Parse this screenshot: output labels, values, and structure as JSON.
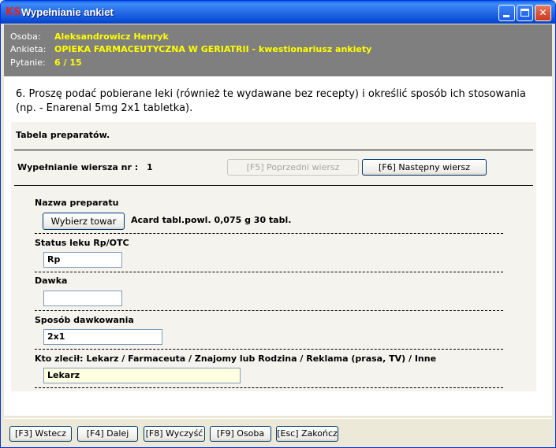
{
  "window": {
    "title": "Wypełnianie ankiet",
    "app_icon": "KS"
  },
  "info": {
    "person_label": "Osoba:",
    "person_value": "Aleksandrowicz Henryk",
    "survey_label": "Ankieta:",
    "survey_value": "OPIEKA FARMACEUTYCZNA W GERIATRII - kwestionariusz ankiety",
    "question_label": "Pytanie:",
    "question_value": "6 / 15"
  },
  "question": {
    "text": "6. Proszę podać pobierane leki (również te wydawane bez recepty) i określić sposób ich stosowania (np. - Enarenal 5mg 2x1 tabletka)."
  },
  "table": {
    "title": "Tabela preparatów.",
    "row_label": "Wypełnianie wiersza nr :",
    "row_number": "1",
    "prev_button": "[F5] Poprzedni wiersz",
    "next_button": "[F6] Następny wiersz"
  },
  "fields": {
    "name_label": "Nazwa preparatu",
    "choose_button": "Wybierz towar",
    "product_name": "Acard tabl.powl. 0,075 g 30 tabl.",
    "status_label": "Status leku Rp/OTC",
    "status_value": "Rp",
    "dose_label": "Dawka",
    "dose_value": "",
    "dosage_label": "Sposób dawkowania",
    "dosage_value": "2x1",
    "prescriber_label": "Kto zlecił: Lekarz / Farmaceuta / Znajomy lub Rodzina / Reklama (prasa, TV) / Inne",
    "prescriber_value": "Lekarz"
  },
  "bottom_buttons": {
    "back": "[F3] Wstecz",
    "next": "[F4] Dalej",
    "clear": "[F8] Wyczyść",
    "person": "[F9] Osoba",
    "finish": "[Esc] Zakończ"
  },
  "colors": {
    "titlebar": "#2a6fe8",
    "info_bg": "#7f7f7f",
    "info_value": "#ffff00",
    "highlight_input": "#ffffe1"
  }
}
